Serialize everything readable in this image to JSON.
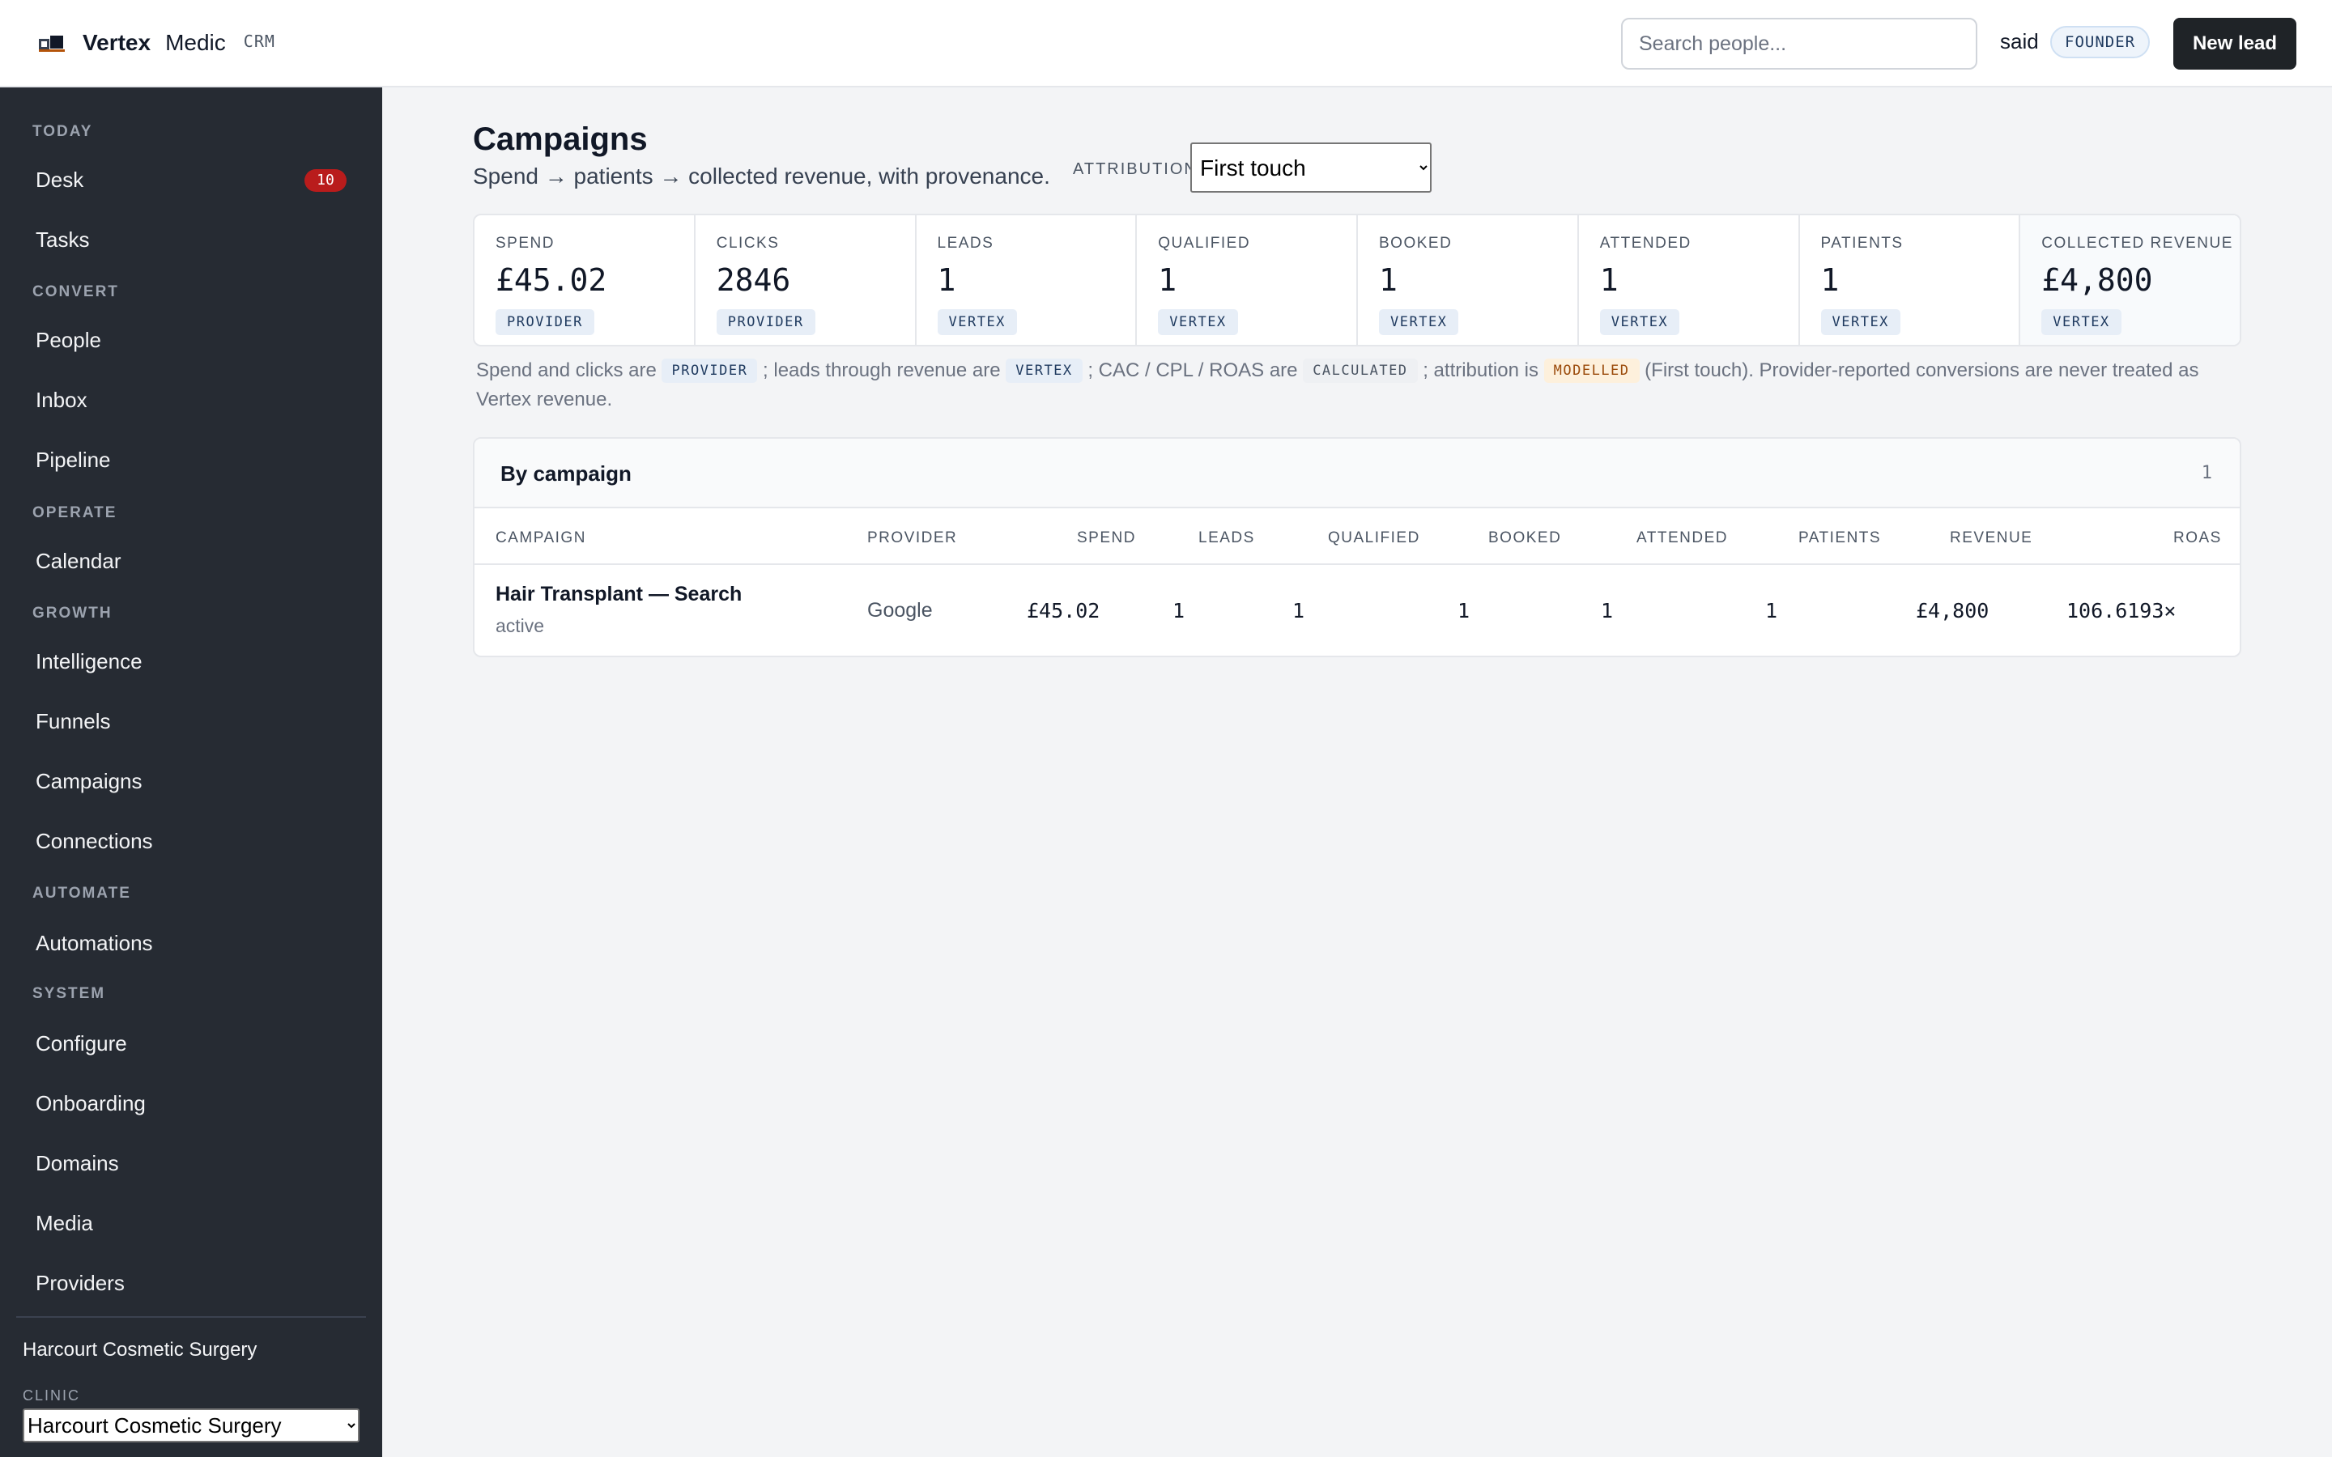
{
  "header": {
    "brand": "Vertex",
    "product": "Medic",
    "tag": "CRM",
    "search_placeholder": "Search people...",
    "user": "said",
    "role": "FOUNDER",
    "new_lead_label": "New lead"
  },
  "sidebar": {
    "sections": {
      "today": "TODAY",
      "convert": "CONVERT",
      "operate": "OPERATE",
      "growth": "GROWTH",
      "automate": "AUTOMATE",
      "system": "SYSTEM"
    },
    "items": {
      "desk": "Desk",
      "desk_badge": "10",
      "tasks": "Tasks",
      "people": "People",
      "inbox": "Inbox",
      "pipeline": "Pipeline",
      "calendar": "Calendar",
      "intelligence": "Intelligence",
      "funnels": "Funnels",
      "campaigns": "Campaigns",
      "connections": "Connections",
      "automations": "Automations",
      "configure": "Configure",
      "onboarding": "Onboarding",
      "domains": "Domains",
      "media": "Media",
      "providers": "Providers"
    },
    "clinic_name": "Harcourt Cosmetic Surgery",
    "clinic_label": "CLINIC",
    "clinic_selected": "Harcourt Cosmetic Surgery"
  },
  "page": {
    "title": "Campaigns",
    "subtitle": "Spend → patients → collected revenue, with provenance.",
    "attribution_label": "ATTRIBUTION",
    "attribution_selected": "First touch"
  },
  "kpis": [
    {
      "label": "SPEND",
      "value": "£45.02",
      "source": "PROVIDER"
    },
    {
      "label": "CLICKS",
      "value": "2846",
      "source": "PROVIDER"
    },
    {
      "label": "LEADS",
      "value": "1",
      "source": "VERTEX"
    },
    {
      "label": "QUALIFIED",
      "value": "1",
      "source": "VERTEX"
    },
    {
      "label": "BOOKED",
      "value": "1",
      "source": "VERTEX"
    },
    {
      "label": "ATTENDED",
      "value": "1",
      "source": "VERTEX"
    },
    {
      "label": "PATIENTS",
      "value": "1",
      "source": "VERTEX"
    },
    {
      "label": "COLLECTED REVENUE",
      "value": "£4,800",
      "source": "VERTEX"
    }
  ],
  "note": {
    "t1": "Spend and clicks are ",
    "c1": "PROVIDER",
    "t2": " ; leads through revenue are ",
    "c2": "VERTEX",
    "t3": " ; CAC / CPL / ROAS are ",
    "c3": "CALCULATED",
    "t4": " ; attribution is ",
    "c4": "MODELLED",
    "t5": " (First touch). Provider-reported conversions are never treated as Vertex revenue."
  },
  "table": {
    "title": "By campaign",
    "count": "1",
    "columns": {
      "campaign": "CAMPAIGN",
      "provider": "PROVIDER",
      "spend": "SPEND",
      "leads": "LEADS",
      "qualified": "QUALIFIED",
      "booked": "BOOKED",
      "attended": "ATTENDED",
      "patients": "PATIENTS",
      "revenue": "REVENUE",
      "roas": "ROAS"
    },
    "rows": [
      {
        "campaign": "Hair Transplant — Search",
        "status": "active",
        "provider": "Google",
        "spend": "£45.02",
        "leads": "1",
        "qualified": "1",
        "booked": "1",
        "attended": "1",
        "patients": "1",
        "revenue": "£4,800",
        "roas": "106.6193×"
      }
    ]
  }
}
